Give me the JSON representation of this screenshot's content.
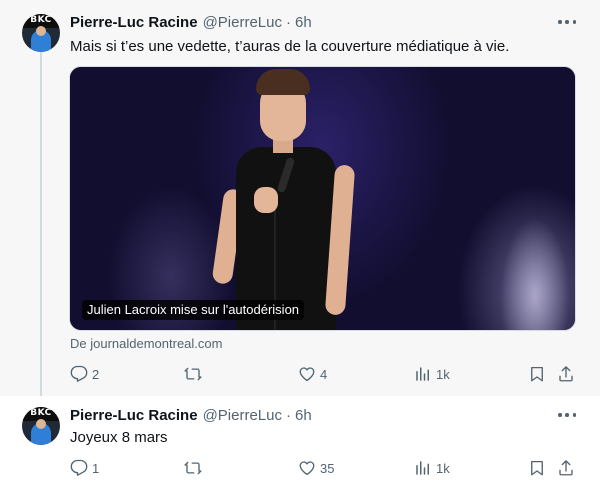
{
  "tweets": [
    {
      "avatar_text": "BKC",
      "author_name": "Pierre-Luc Racine",
      "author_handle": "@PierreLuc",
      "separator": "·",
      "time": "6h",
      "text": "Mais si t’es une vedette, t’auras de la couverture médiatique à vie.",
      "media_caption": "Julien Lacroix mise sur l'autodérision",
      "source": "De journaldemontreal.com",
      "replies": "2",
      "retweets": "",
      "likes": "4",
      "views": "1k"
    },
    {
      "avatar_text": "BKC",
      "author_name": "Pierre-Luc Racine",
      "author_handle": "@PierreLuc",
      "separator": "·",
      "time": "6h",
      "text": "Joyeux 8 mars",
      "replies": "1",
      "retweets": "",
      "likes": "35",
      "views": "1k"
    }
  ],
  "icons": {
    "reply": "reply-icon",
    "retweet": "retweet-icon",
    "like": "heart-icon",
    "views": "views-icon",
    "bookmark": "bookmark-icon",
    "share": "share-icon",
    "more": "more-icon"
  },
  "colors": {
    "text_primary": "#0f1419",
    "text_secondary": "#536471",
    "thread_line": "#cfd9de"
  }
}
